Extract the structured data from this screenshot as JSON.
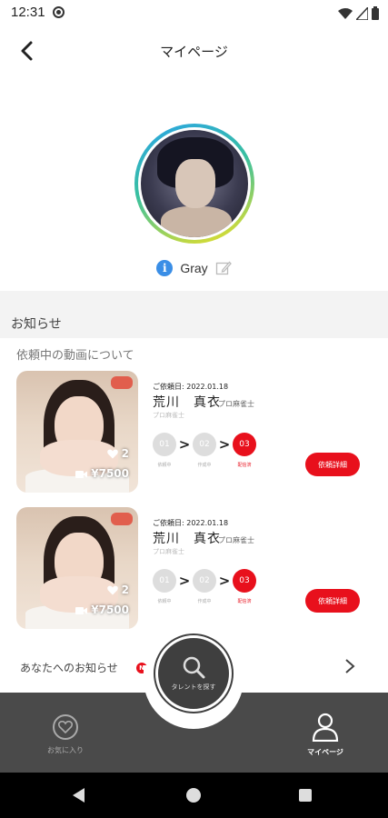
{
  "status_bar": {
    "time": "12:31"
  },
  "header": {
    "title": "マイページ"
  },
  "profile": {
    "name": "Gray",
    "info_icon": "i"
  },
  "notices_section": {
    "title": "お知らせ"
  },
  "requests": {
    "title": "依頼中の動画について",
    "cards": [
      {
        "date": "ご依頼日: 2022.01.18",
        "name": "荒川　真衣",
        "role": "プロ麻雀士",
        "role_sub": "プロ麻雀士",
        "likes": "2",
        "price": "¥7500",
        "steps": [
          {
            "num": "01",
            "label": "依頼中"
          },
          {
            "num": "02",
            "label": "作成中"
          },
          {
            "num": "03",
            "label": "配信済"
          }
        ],
        "active_step": 3,
        "detail_label": "依頼詳細"
      },
      {
        "date": "ご依頼日: 2022.01.18",
        "name": "荒川　真衣",
        "role": "プロ麻雀士",
        "role_sub": "プロ麻雀士",
        "likes": "2",
        "price": "¥7500",
        "steps": [
          {
            "num": "01",
            "label": "依頼中"
          },
          {
            "num": "02",
            "label": "作成中"
          },
          {
            "num": "03",
            "label": "配信済"
          }
        ],
        "active_step": 3,
        "detail_label": "依頼詳細"
      }
    ]
  },
  "notice_row": {
    "label": "あなたへのお知らせ",
    "badge": "N"
  },
  "search_fab": {
    "label": "タレントを探す"
  },
  "tabs": {
    "favorite": "お気に入り",
    "mypage": "マイページ"
  },
  "colors": {
    "accent": "#e8101c",
    "tab_bar": "#4a4a4a",
    "info": "#3a8ee6"
  }
}
